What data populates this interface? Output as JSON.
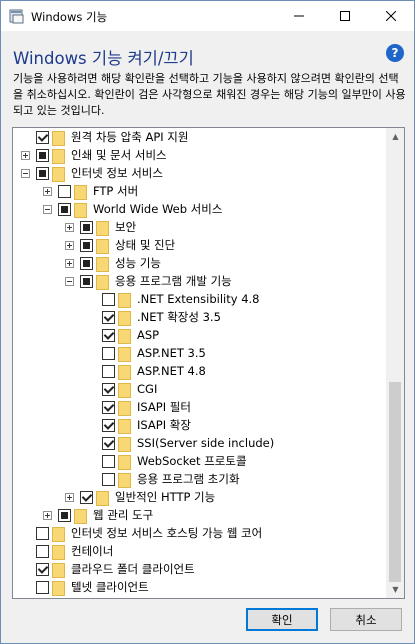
{
  "window": {
    "title": "Windows 기능",
    "minimize_glyph": "—",
    "maximize_glyph": "☐",
    "close_glyph": "✕"
  },
  "heading": "Windows 기능 켜기/끄기",
  "help_glyph": "?",
  "description": "기능을 사용하려면 해당 확인란을 선택하고 기능을 사용하지 않으려면 확인란의 선택을 취소하십시오. 확인란이 검은 사각형으로 채워진 경우는 해당 기능의 일부만이 사용되고 있는 것입니다.",
  "tree": [
    {
      "label": "원격 차등 압축 API 지원",
      "level": 0,
      "expander": "none",
      "state": "checked"
    },
    {
      "label": "인쇄 및 문서 서비스",
      "level": 0,
      "expander": "plus",
      "state": "partial"
    },
    {
      "label": "인터넷 정보 서비스",
      "level": 0,
      "expander": "minus",
      "state": "partial"
    },
    {
      "label": "FTP 서버",
      "level": 1,
      "expander": "plus",
      "state": "unchecked"
    },
    {
      "label": "World Wide Web 서비스",
      "level": 1,
      "expander": "minus",
      "state": "partial"
    },
    {
      "label": "보안",
      "level": 2,
      "expander": "plus",
      "state": "partial"
    },
    {
      "label": "상태 및 진단",
      "level": 2,
      "expander": "plus",
      "state": "partial"
    },
    {
      "label": "성능 기능",
      "level": 2,
      "expander": "plus",
      "state": "partial"
    },
    {
      "label": "응용 프로그램 개발 기능",
      "level": 2,
      "expander": "minus",
      "state": "partial"
    },
    {
      "label": ".NET Extensibility 4.8",
      "level": 3,
      "expander": "none",
      "state": "unchecked"
    },
    {
      "label": ".NET 확장성 3.5",
      "level": 3,
      "expander": "none",
      "state": "checked"
    },
    {
      "label": "ASP",
      "level": 3,
      "expander": "none",
      "state": "checked"
    },
    {
      "label": "ASP.NET 3.5",
      "level": 3,
      "expander": "none",
      "state": "unchecked"
    },
    {
      "label": "ASP.NET 4.8",
      "level": 3,
      "expander": "none",
      "state": "unchecked"
    },
    {
      "label": "CGI",
      "level": 3,
      "expander": "none",
      "state": "checked"
    },
    {
      "label": "ISAPI 필터",
      "level": 3,
      "expander": "none",
      "state": "checked"
    },
    {
      "label": "ISAPI 확장",
      "level": 3,
      "expander": "none",
      "state": "checked"
    },
    {
      "label": "SSI(Server side include)",
      "level": 3,
      "expander": "none",
      "state": "checked"
    },
    {
      "label": "WebSocket 프로토콜",
      "level": 3,
      "expander": "none",
      "state": "unchecked"
    },
    {
      "label": "응용 프로그램 초기화",
      "level": 3,
      "expander": "none",
      "state": "unchecked"
    },
    {
      "label": "일반적인 HTTP 기능",
      "level": 2,
      "expander": "plus",
      "state": "checked"
    },
    {
      "label": "웹 관리 도구",
      "level": 1,
      "expander": "plus",
      "state": "partial"
    },
    {
      "label": "인터넷 정보 서비스 호스팅 가능 웹 코어",
      "level": 0,
      "expander": "none",
      "state": "unchecked"
    },
    {
      "label": "컨테이너",
      "level": 0,
      "expander": "none",
      "state": "unchecked"
    },
    {
      "label": "클라우드 폴더 클라이언트",
      "level": 0,
      "expander": "none",
      "state": "checked"
    },
    {
      "label": "텔넷 클라이언트",
      "level": 0,
      "expander": "none",
      "state": "unchecked"
    }
  ],
  "buttons": {
    "ok": "확인",
    "cancel": "취소"
  }
}
